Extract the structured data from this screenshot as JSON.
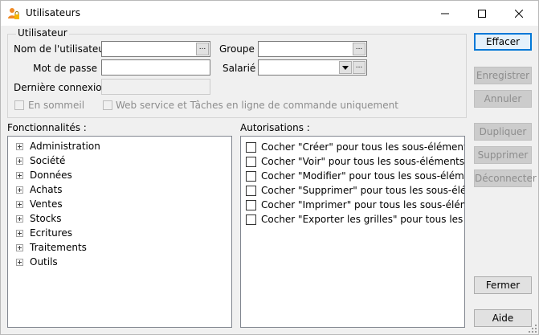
{
  "window": {
    "title": "Utilisateurs",
    "minimize_icon": "minimize-icon",
    "maximize_icon": "maximize-icon",
    "close_icon": "close-icon"
  },
  "user_group": {
    "title": "Utilisateur",
    "username_label": "Nom de l'utilisateur",
    "username_value": "",
    "password_label": "Mot de passe",
    "password_value": "",
    "last_login_label": "Dernière connexion",
    "last_login_value": "",
    "group_label": "Groupe",
    "group_value": "",
    "employee_label": "Salarié",
    "employee_value": "",
    "ellipsis": "...",
    "sleep_label": "En sommeil",
    "webservice_label": "Web service et Tâches en ligne de commande uniquement"
  },
  "features": {
    "label": "Fonctionnalités :",
    "items": [
      "Administration",
      "Société",
      "Données",
      "Achats",
      "Ventes",
      "Stocks",
      "Ecritures",
      "Traitements",
      "Outils"
    ]
  },
  "authorizations": {
    "label": "Autorisations :",
    "items": [
      "Cocher \"Créer\" pour tous les sous-éléments",
      "Cocher \"Voir\" pour tous les sous-éléments",
      "Cocher \"Modifier\" pour tous les sous-éléments",
      "Cocher \"Supprimer\" pour tous les sous-éléme",
      "Cocher \"Imprimer\" pour tous les sous-éléments",
      "Cocher \"Exporter les grilles\" pour tous les sous..."
    ]
  },
  "buttons": {
    "clear": "Effacer",
    "save": "Enregistrer",
    "cancel": "Annuler",
    "duplicate": "Dupliquer",
    "delete": "Supprimer",
    "disconnect": "Déconnecter",
    "close": "Fermer",
    "help": "Aide"
  },
  "colors": {
    "accent": "#0078d7",
    "window_bg": "#f0f0f0",
    "selection": "#cce8ff"
  }
}
